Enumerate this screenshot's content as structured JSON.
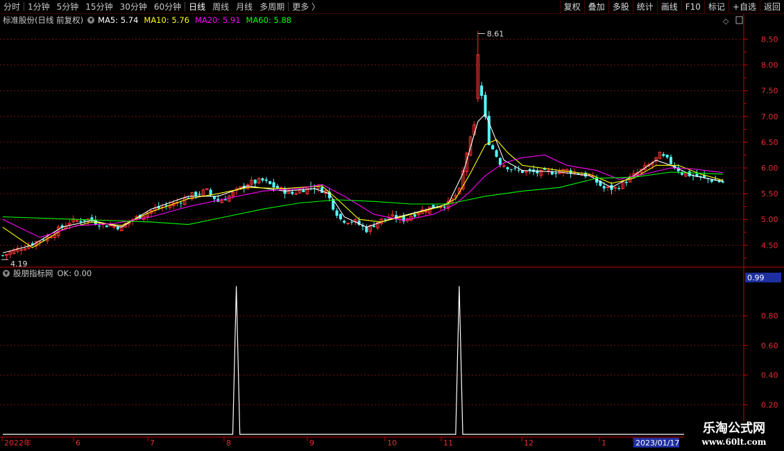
{
  "toolbar": {
    "periods": [
      "分时",
      "1分钟",
      "5分钟",
      "15分钟",
      "30分钟",
      "60分钟",
      "日线",
      "周线",
      "月线",
      "多周期",
      "更多"
    ],
    "active_period": "日线",
    "more_arrow": "〉",
    "right_buttons": [
      "复权",
      "叠加",
      "多股",
      "统计",
      "画线",
      "F10",
      "标记",
      "+自选",
      "返回"
    ]
  },
  "legend": {
    "stock": "标准股份(日线 前复权)",
    "ma": [
      {
        "label": "MA5: 5.74",
        "color": "#ffffff"
      },
      {
        "label": "MA10: 5.76",
        "color": "#ffff00"
      },
      {
        "label": "MA20: 5.91",
        "color": "#ff00ff"
      },
      {
        "label": "MA60: 5.88",
        "color": "#00ff00"
      }
    ]
  },
  "indicator": {
    "label": "股朋指标网",
    "value": "OK: 0.00",
    "current_value": "0.99"
  },
  "annotations": {
    "high": "8.61",
    "low": "4.19"
  },
  "colors": {
    "up": "#ff3232",
    "down": "#54ffff",
    "grid": "#7a1010",
    "axis": "#c80000"
  },
  "chart_data": [
    {
      "type": "candlestick",
      "title": "",
      "ylim": [
        4.1,
        8.75
      ],
      "yticks": [
        "8.50",
        "8.00",
        "7.50",
        "7.00",
        "6.50",
        "6.00",
        "5.50",
        "5.00",
        "4.50"
      ],
      "ytick_values": [
        8.5,
        8.0,
        7.5,
        7.0,
        6.5,
        6.0,
        5.5,
        5.0,
        4.5
      ],
      "x_labels": [
        "2022年",
        "6",
        "7",
        "8",
        "9",
        "10",
        "11",
        "12",
        "1",
        "2023/01/17"
      ],
      "close_trend": [
        [
          0,
          4.3
        ],
        [
          5,
          4.45
        ],
        [
          12,
          4.65
        ],
        [
          18,
          4.95
        ],
        [
          23,
          5.0
        ],
        [
          27,
          4.9
        ],
        [
          32,
          4.85
        ],
        [
          35,
          5.0
        ],
        [
          41,
          5.2
        ],
        [
          46,
          5.3
        ],
        [
          52,
          5.5
        ],
        [
          55,
          5.55
        ],
        [
          58,
          5.35
        ],
        [
          61,
          5.45
        ],
        [
          66,
          5.7
        ],
        [
          70,
          5.75
        ],
        [
          74,
          5.6
        ],
        [
          78,
          5.5
        ],
        [
          83,
          5.65
        ],
        [
          87,
          5.55
        ],
        [
          89,
          5.25
        ],
        [
          91,
          5.0
        ],
        [
          95,
          4.95
        ],
        [
          98,
          4.8
        ],
        [
          101,
          4.95
        ],
        [
          104,
          5.05
        ],
        [
          108,
          5.0
        ],
        [
          112,
          5.15
        ],
        [
          116,
          5.25
        ],
        [
          120,
          5.3
        ],
        [
          123,
          5.55
        ],
        [
          125,
          6.3
        ],
        [
          127,
          6.8
        ],
        [
          128,
          7.9
        ],
        [
          129,
          7.4
        ],
        [
          131,
          6.5
        ],
        [
          134,
          6.1
        ],
        [
          138,
          5.95
        ],
        [
          145,
          5.9
        ],
        [
          152,
          5.95
        ],
        [
          158,
          5.85
        ],
        [
          162,
          5.6
        ],
        [
          165,
          5.6
        ],
        [
          168,
          5.75
        ],
        [
          172,
          5.95
        ],
        [
          175,
          6.1
        ],
        [
          177,
          6.25
        ],
        [
          180,
          6.1
        ],
        [
          183,
          5.9
        ],
        [
          186,
          5.85
        ],
        [
          190,
          5.78
        ],
        [
          194,
          5.72
        ]
      ],
      "series": [
        {
          "name": "MA5",
          "values": [
            [
              0,
              4.35
            ],
            [
              8,
              4.5
            ],
            [
              16,
              4.85
            ],
            [
              24,
              4.98
            ],
            [
              32,
              4.85
            ],
            [
              40,
              5.2
            ],
            [
              50,
              5.45
            ],
            [
              58,
              5.45
            ],
            [
              66,
              5.65
            ],
            [
              76,
              5.55
            ],
            [
              84,
              5.6
            ],
            [
              88,
              5.5
            ],
            [
              92,
              5.05
            ],
            [
              98,
              4.85
            ],
            [
              104,
              5.0
            ],
            [
              112,
              5.15
            ],
            [
              120,
              5.3
            ],
            [
              124,
              5.9
            ],
            [
              128,
              6.9
            ],
            [
              130,
              7.05
            ],
            [
              132,
              6.7
            ],
            [
              135,
              6.15
            ],
            [
              140,
              5.95
            ],
            [
              150,
              5.92
            ],
            [
              158,
              5.85
            ],
            [
              164,
              5.62
            ],
            [
              170,
              5.85
            ],
            [
              176,
              6.15
            ],
            [
              180,
              6.05
            ],
            [
              186,
              5.85
            ],
            [
              194,
              5.74
            ]
          ]
        },
        {
          "name": "MA10",
          "values": [
            [
              0,
              4.85
            ],
            [
              8,
              4.45
            ],
            [
              16,
              4.8
            ],
            [
              24,
              4.95
            ],
            [
              32,
              4.88
            ],
            [
              40,
              5.15
            ],
            [
              50,
              5.4
            ],
            [
              58,
              5.5
            ],
            [
              66,
              5.62
            ],
            [
              76,
              5.6
            ],
            [
              86,
              5.65
            ],
            [
              90,
              5.4
            ],
            [
              96,
              5.0
            ],
            [
              102,
              4.95
            ],
            [
              110,
              5.1
            ],
            [
              118,
              5.25
            ],
            [
              122,
              5.4
            ],
            [
              126,
              5.9
            ],
            [
              130,
              6.45
            ],
            [
              133,
              6.55
            ],
            [
              136,
              6.3
            ],
            [
              140,
              6.05
            ],
            [
              150,
              5.95
            ],
            [
              158,
              5.88
            ],
            [
              164,
              5.7
            ],
            [
              170,
              5.8
            ],
            [
              176,
              6.05
            ],
            [
              182,
              6.05
            ],
            [
              188,
              5.88
            ],
            [
              194,
              5.76
            ]
          ]
        },
        {
          "name": "MA20",
          "values": [
            [
              0,
              5.0
            ],
            [
              10,
              4.65
            ],
            [
              20,
              4.88
            ],
            [
              30,
              4.92
            ],
            [
              40,
              5.05
            ],
            [
              50,
              5.25
            ],
            [
              60,
              5.4
            ],
            [
              70,
              5.55
            ],
            [
              80,
              5.6
            ],
            [
              86,
              5.68
            ],
            [
              92,
              5.45
            ],
            [
              100,
              5.1
            ],
            [
              108,
              4.98
            ],
            [
              116,
              5.1
            ],
            [
              122,
              5.3
            ],
            [
              126,
              5.55
            ],
            [
              130,
              5.85
            ],
            [
              135,
              6.1
            ],
            [
              140,
              6.2
            ],
            [
              146,
              6.25
            ],
            [
              152,
              6.05
            ],
            [
              160,
              5.95
            ],
            [
              166,
              5.78
            ],
            [
              174,
              5.9
            ],
            [
              180,
              6.0
            ],
            [
              186,
              5.98
            ],
            [
              194,
              5.91
            ]
          ]
        },
        {
          "name": "MA60",
          "values": [
            [
              0,
              5.05
            ],
            [
              20,
              5.0
            ],
            [
              40,
              4.95
            ],
            [
              50,
              4.9
            ],
            [
              60,
              5.05
            ],
            [
              70,
              5.2
            ],
            [
              80,
              5.32
            ],
            [
              90,
              5.38
            ],
            [
              100,
              5.35
            ],
            [
              110,
              5.3
            ],
            [
              120,
              5.3
            ],
            [
              130,
              5.45
            ],
            [
              140,
              5.55
            ],
            [
              150,
              5.62
            ],
            [
              160,
              5.8
            ],
            [
              170,
              5.82
            ],
            [
              180,
              5.92
            ],
            [
              194,
              5.88
            ]
          ]
        }
      ]
    },
    {
      "type": "line",
      "title": "",
      "ylim": [
        0,
        1.03
      ],
      "yticks": [
        "0.80",
        "0.60",
        "0.40",
        "0.20"
      ],
      "ytick_values": [
        0.8,
        0.6,
        0.4,
        0.2
      ],
      "series": [
        {
          "name": "",
          "values": [
            [
              0,
              0
            ],
            [
              65,
              0
            ],
            [
              66,
              1
            ],
            [
              67,
              0
            ],
            [
              128,
              0
            ],
            [
              129,
              1
            ],
            [
              130,
              0
            ],
            [
              200,
              0
            ]
          ]
        }
      ]
    }
  ]
}
